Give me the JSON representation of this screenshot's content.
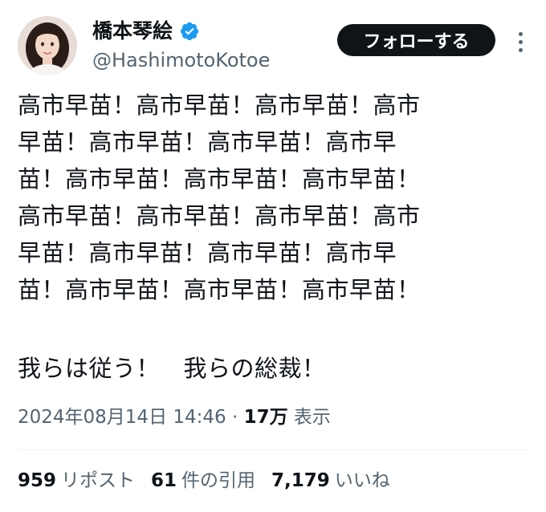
{
  "user": {
    "display_name": "橋本琴絵",
    "handle": "@HashimotoKotoe",
    "verified_icon": "verified-badge-icon",
    "verified_color": "#1d9bf0"
  },
  "follow_button": {
    "label": "フォローする"
  },
  "tweet": {
    "lines": [
      "高市早苗！高市早苗！高市早苗！高市",
      "早苗！高市早苗！高市早苗！高市早",
      "苗！高市早苗！高市早苗！高市早苗！",
      "高市早苗！高市早苗！高市早苗！高市",
      "早苗！高市早苗！高市早苗！高市早",
      "苗！高市早苗！高市早苗！高市早苗！"
    ],
    "closing_line": "我らは従う！　我らの総裁！"
  },
  "meta": {
    "timestamp": "2024年08月14日 14:46",
    "separator": " · ",
    "views_count": "17万",
    "views_label": " 表示"
  },
  "stats": {
    "reposts": {
      "count": "959",
      "label": "リポスト"
    },
    "quotes": {
      "count": "61",
      "label": "件の引用"
    },
    "likes": {
      "count": "7,179",
      "label": "いいね"
    }
  },
  "colors": {
    "text_primary": "#0f1419",
    "text_secondary": "#536471",
    "button_bg": "#0f1419",
    "divider": "#eff3f4"
  }
}
